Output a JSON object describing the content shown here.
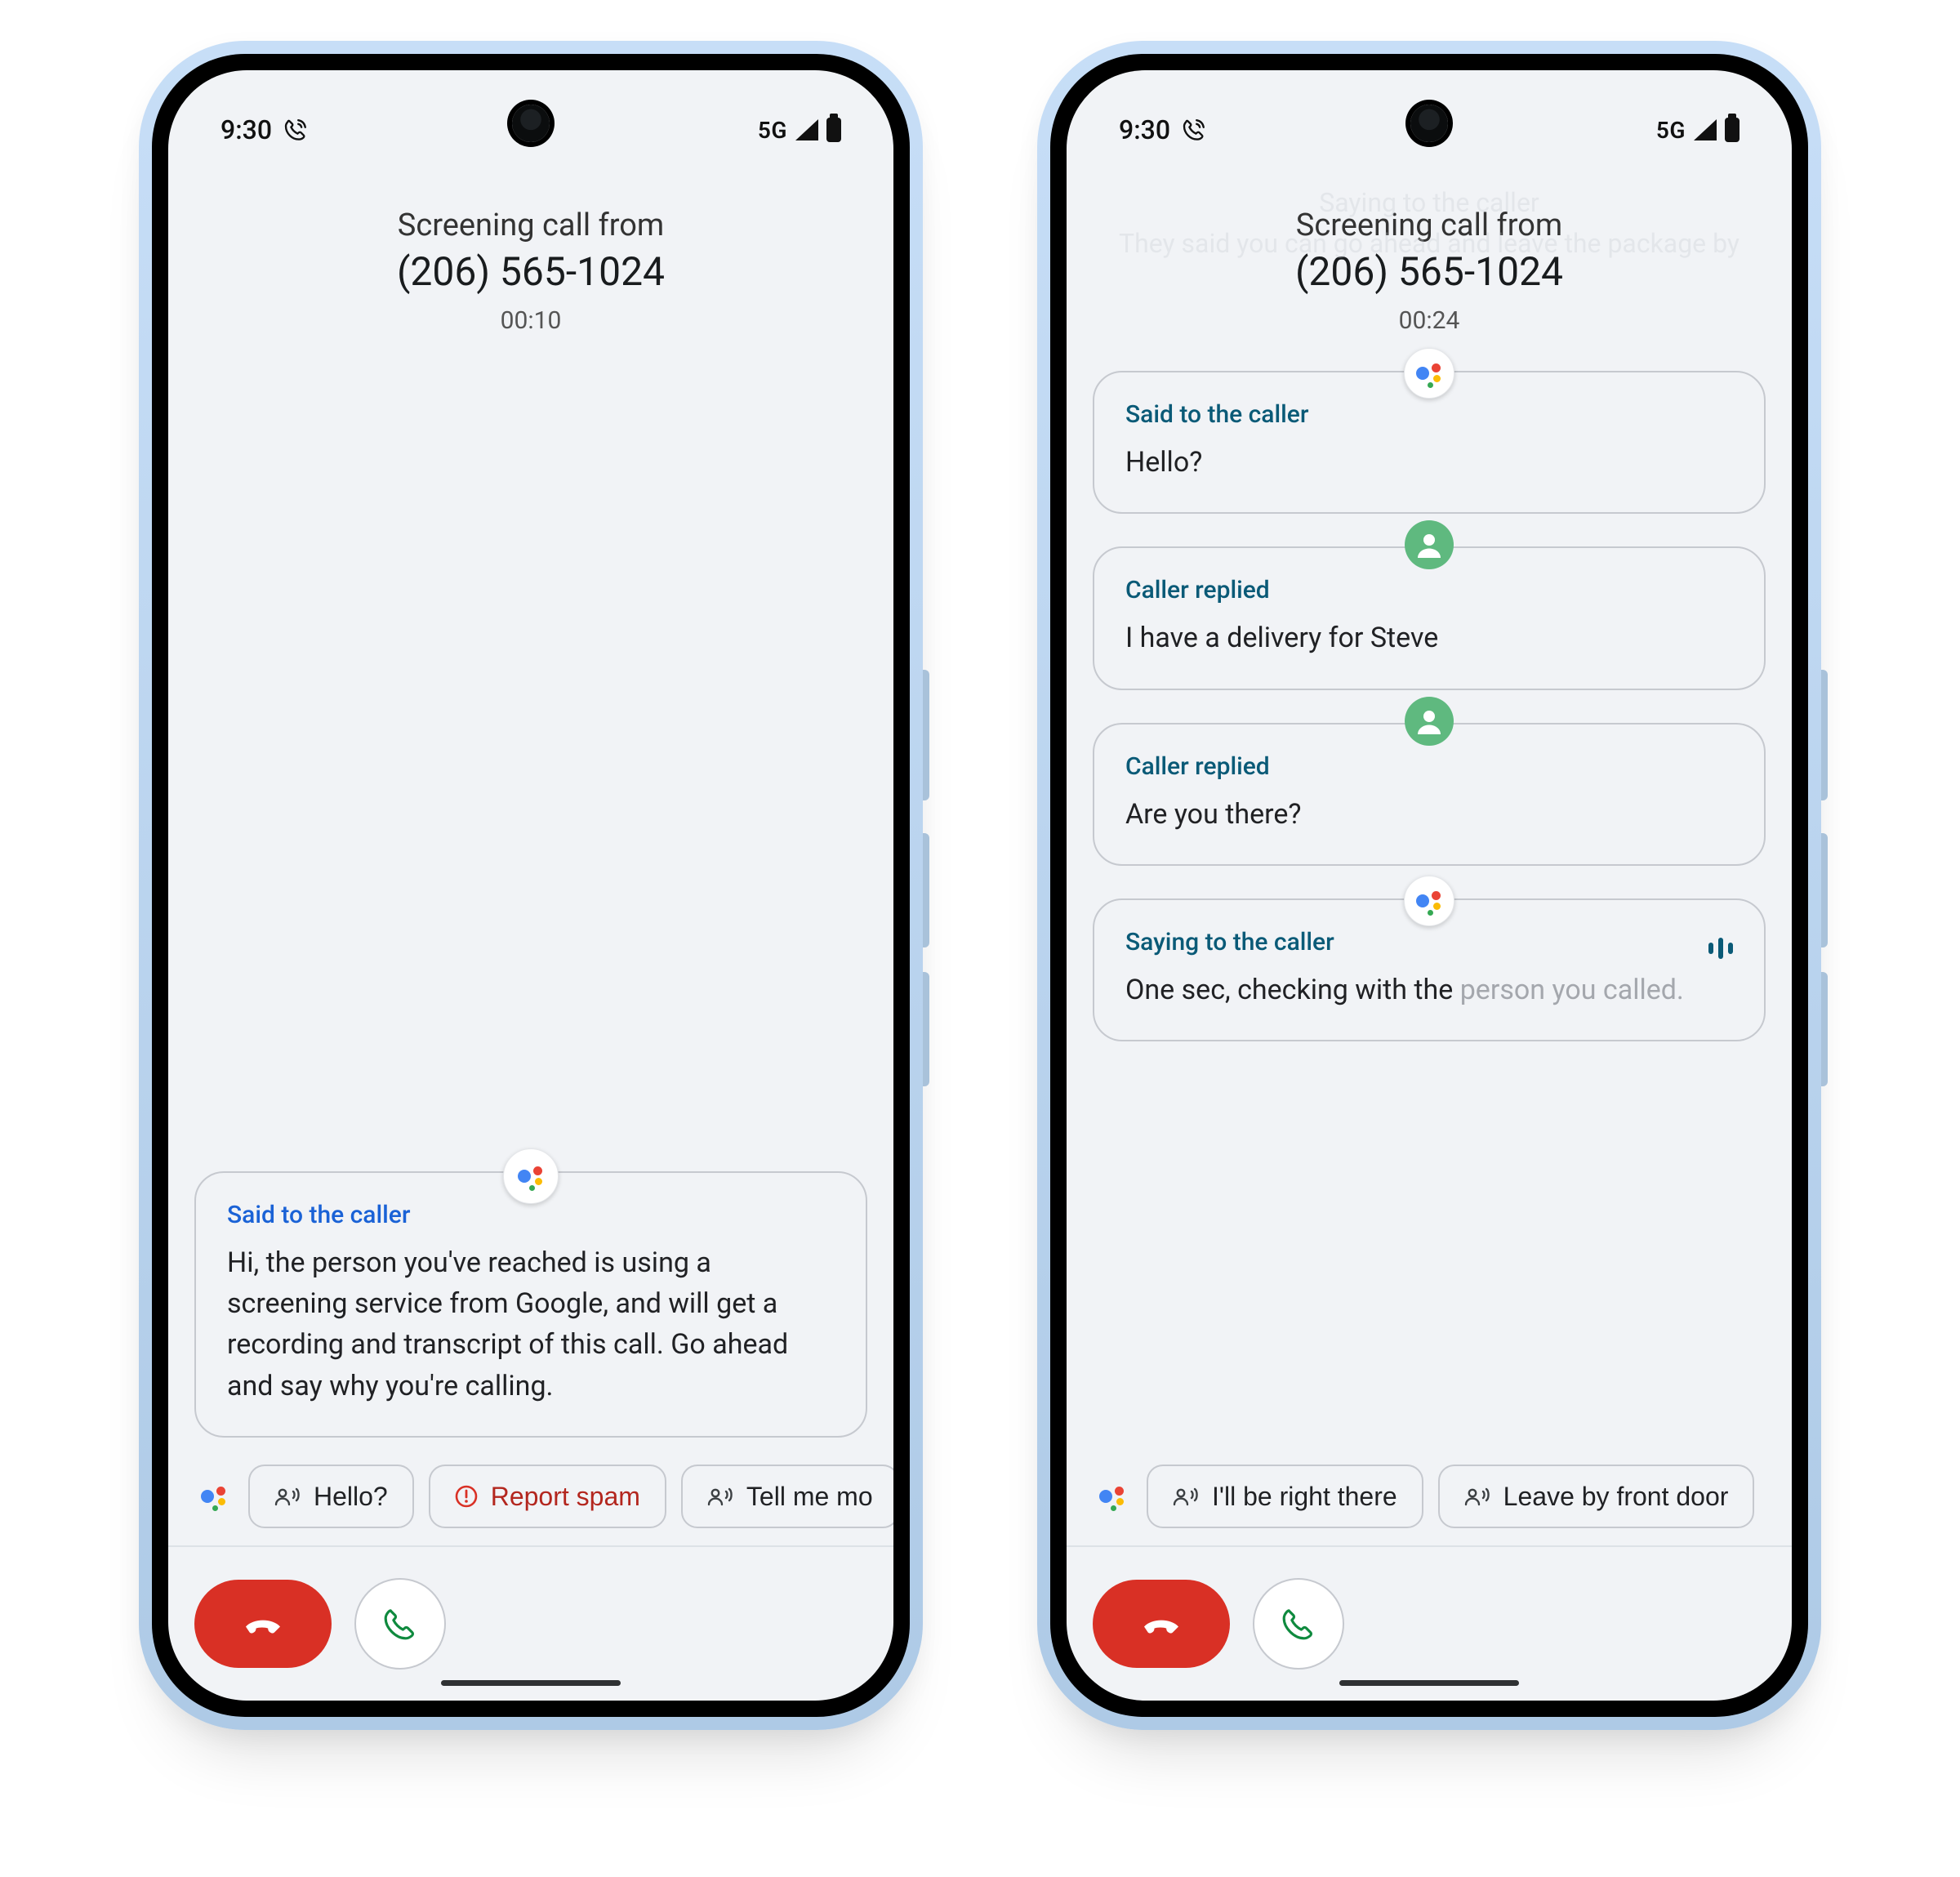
{
  "status": {
    "time": "9:30",
    "network": "5G"
  },
  "phone1": {
    "title": "Screening call from",
    "number": "(206) 565-1024",
    "timer": "00:10",
    "card": {
      "label": "Said to the caller",
      "body": "Hi, the person you've reached is using a screening service from Google, and will get a recording and transcript of this call. Go ahead and say why you're calling."
    },
    "chips": [
      "Hello?",
      "Report spam",
      "Tell me mo"
    ]
  },
  "phone2": {
    "title": "Screening call from",
    "number": "(206) 565-1024",
    "timer": "00:24",
    "ghost_lines": "Saying to the caller\nThey said you can go ahead and leave the package by",
    "cards": [
      {
        "kind": "assistant",
        "label": "Said to the caller",
        "body": "Hello?"
      },
      {
        "kind": "caller",
        "label": "Caller replied",
        "body": "I have a delivery for Steve"
      },
      {
        "kind": "caller",
        "label": "Caller replied",
        "body": "Are you there?"
      },
      {
        "kind": "live",
        "label": "Saying to the caller",
        "body": "One sec, checking with the ",
        "body_faded": "person you called."
      }
    ],
    "chips": [
      "I'll be right there",
      "Leave by front door"
    ]
  }
}
